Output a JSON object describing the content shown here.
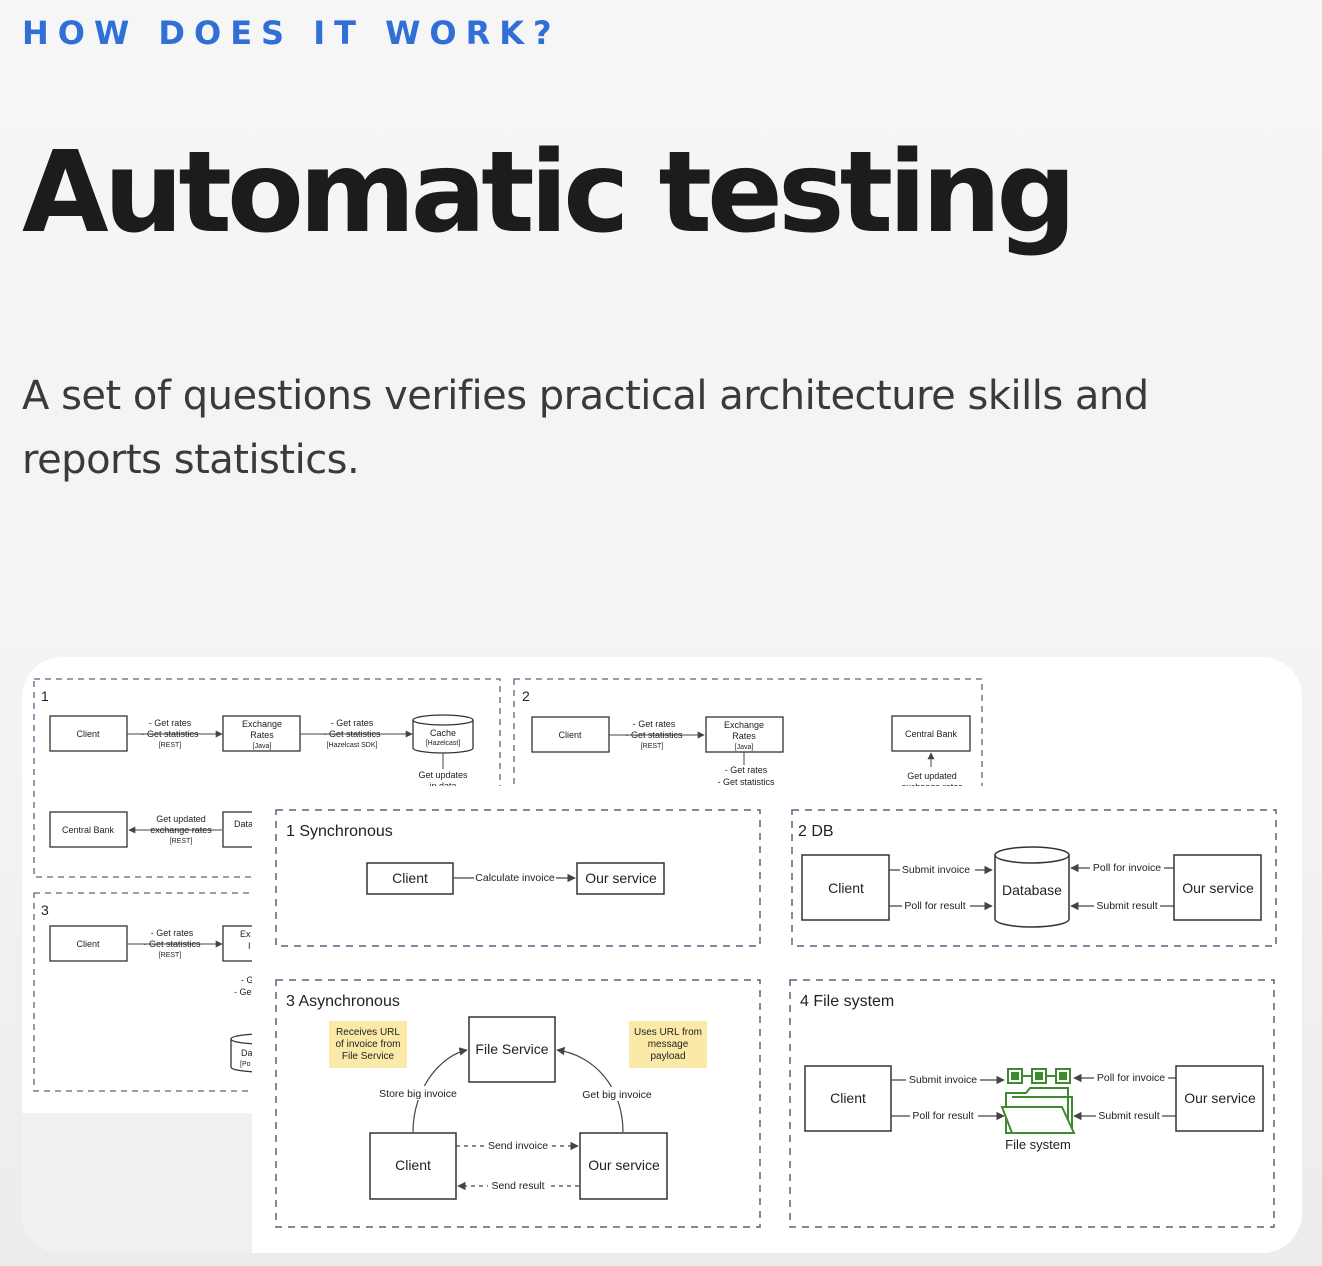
{
  "header": {
    "eyebrow": "HOW DOES IT WORK?",
    "title": "Automatic testing",
    "description": "A set of questions verifies practical architecture skills and reports statistics."
  },
  "colors": {
    "accent": "#2f6fd6",
    "title": "#1c1c1e",
    "sticky": "#fbeaa7",
    "file_icon": "#3d8b2e",
    "dashed_border": "#5a6480"
  },
  "back_diagram": {
    "panel1": {
      "number": "1",
      "client": "Client",
      "edge1_line1": "- Get rates",
      "edge1_line2": "- Get statistics",
      "edge1_tag": "[REST]",
      "rates_line1": "Exchange",
      "rates_line2": "Rates",
      "rates_tag": "[Java]",
      "edge2_line1": "- Get rates",
      "edge2_line2": "- Get statistics",
      "edge2_tag": "[Hazelcast SDK]",
      "cache": "Cache",
      "cache_tag": "[Hazelcast]",
      "updates_line1": "Get updates",
      "updates_line2": "in data",
      "central_bank": "Central Bank",
      "cb_edge_line1": "Get updated",
      "cb_edge_line2": "exchange rates",
      "cb_edge_tag": "[REST]",
      "data": "Data"
    },
    "panel2": {
      "number": "2",
      "client": "Client",
      "edge1_line1": "- Get rates",
      "edge1_line2": "- Get statistics",
      "edge1_tag": "[REST]",
      "rates_line1": "Exchange",
      "rates_line2": "Rates",
      "rates_tag": "[Java]",
      "under_line1": "- Get rates",
      "under_line2": "- Get statistics",
      "central_bank": "Central Bank",
      "cb_line1": "Get updated",
      "cb_line2": "exchange rates"
    },
    "panel3": {
      "number": "3",
      "client": "Client",
      "edge1_line1": "- Get rates",
      "edge1_line2": "- Get statistics",
      "edge1_tag": "[REST]",
      "rates_partial": "Ex",
      "rates_partial2": "I",
      "get_line1": "- G",
      "get_line2": "- Get",
      "db_partial": "Da",
      "db_tag_partial": "[Po"
    }
  },
  "front_diagram": {
    "sync": {
      "title": "1 Synchronous",
      "client": "Client",
      "edge": "Calculate invoice",
      "service": "Our service"
    },
    "db": {
      "title": "2 DB",
      "client": "Client",
      "submit": "Submit invoice",
      "poll_result": "Poll for result",
      "database": "Database",
      "poll_invoice": "Poll for invoice",
      "submit_result": "Submit result",
      "service": "Our service"
    },
    "async": {
      "title": "3 Asynchronous",
      "note1_line1": "Receives URL",
      "note1_line2": "of invoice from",
      "note1_line3": "File Service",
      "file_service": "File Service",
      "note2_line1": "Uses URL from",
      "note2_line2": "message",
      "note2_line3": "payload",
      "store": "Store big invoice",
      "get": "Get big invoice",
      "client": "Client",
      "send_invoice": "Send invoice",
      "send_result": "Send result",
      "service": "Our service"
    },
    "fs": {
      "title": "4 File system",
      "client": "Client",
      "submit": "Submit invoice",
      "poll_result": "Poll for result",
      "poll_invoice": "Poll for invoice",
      "submit_result": "Submit result",
      "file_system": "File system",
      "service": "Our service"
    }
  }
}
